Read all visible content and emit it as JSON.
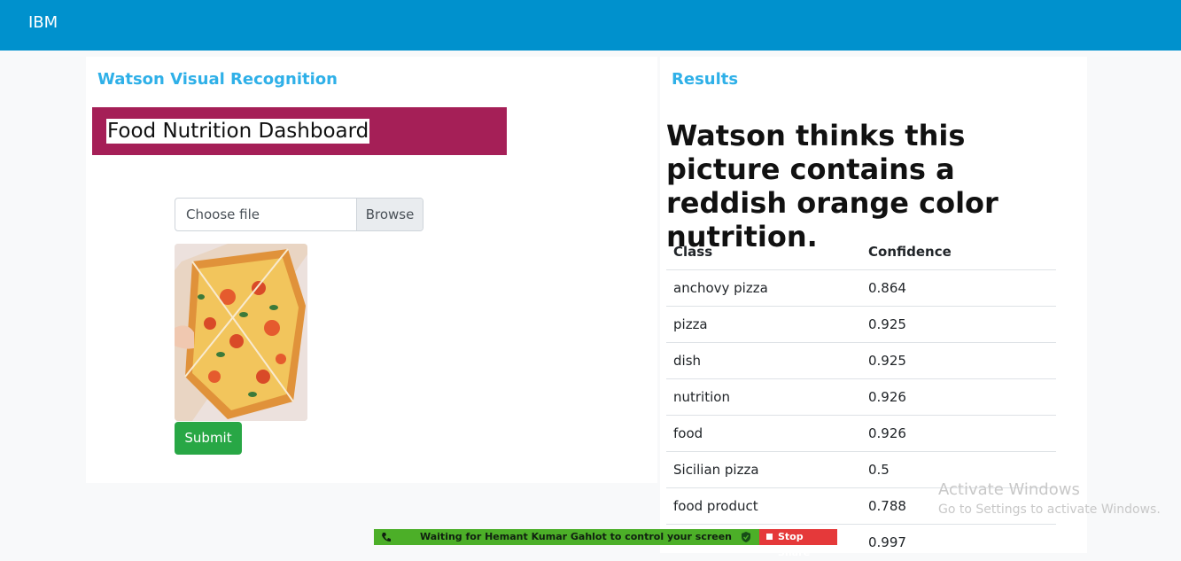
{
  "navbar": {
    "brand": "IBM"
  },
  "left_panel": {
    "title": "Watson Visual Recognition",
    "dashboard_title": "Food Nutrition Dashboard",
    "file_input": {
      "placeholder": "Choose file",
      "browse_label": "Browse"
    },
    "submit_label": "Submit"
  },
  "right_panel": {
    "title": "Results",
    "heading": "Watson thinks this picture contains a reddish orange color nutrition.",
    "table": {
      "headers": [
        "Class",
        "Confidence"
      ],
      "rows": [
        [
          "anchovy pizza",
          "0.864"
        ],
        [
          "pizza",
          "0.925"
        ],
        [
          "dish",
          "0.925"
        ],
        [
          "nutrition",
          "0.926"
        ],
        [
          "food",
          "0.926"
        ],
        [
          "Sicilian pizza",
          "0.5"
        ],
        [
          "food product",
          "0.788"
        ],
        [
          "",
          "0.997"
        ]
      ]
    }
  },
  "windows_watermark": {
    "title": "Activate Windows",
    "subtitle": "Go to Settings to activate Windows."
  },
  "screen_share": {
    "status": "Waiting for Hemant Kumar Gahlot to control your screen",
    "stop_label": "Stop Share"
  },
  "colors": {
    "navbar": "#0091cd",
    "accent_title": "#2fb0e8",
    "banner": "#a51f57",
    "submit": "#28a745",
    "share_bar": "#4caf28",
    "stop_share": "#e5393a"
  }
}
